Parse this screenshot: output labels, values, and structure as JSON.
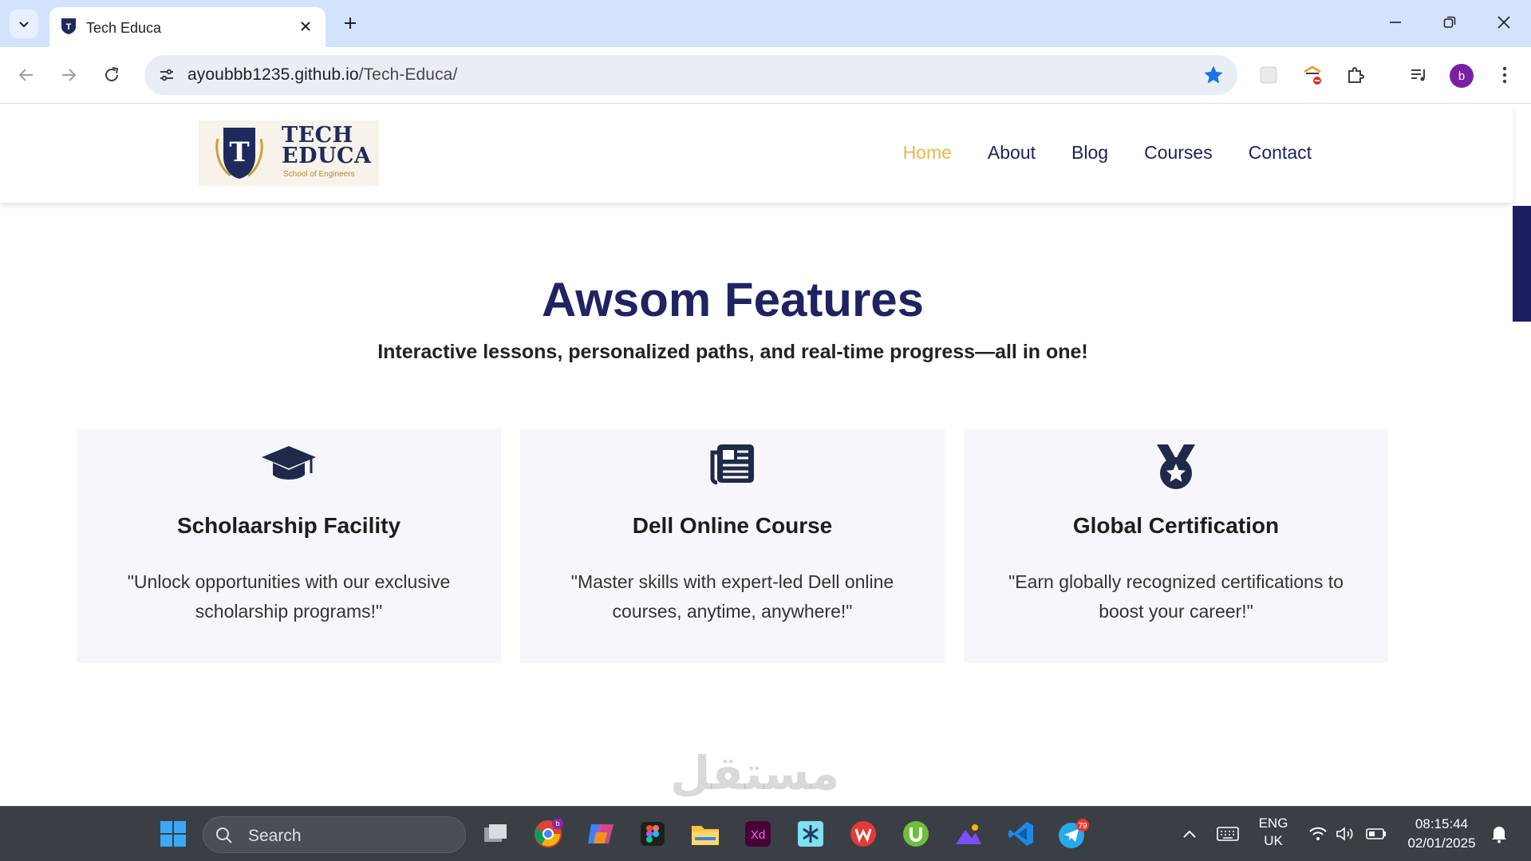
{
  "browser": {
    "tab_title": "Tech Educa",
    "url_host": "ayoubbb1235.github.io",
    "url_path": "/Tech-Educa/",
    "profile_initial": "b"
  },
  "site": {
    "logo": {
      "word1": "TECH",
      "word2": "EDUCA",
      "tagline": "School of Engineers",
      "letter": "T"
    },
    "nav": [
      {
        "label": "Home",
        "active": true
      },
      {
        "label": "About",
        "active": false
      },
      {
        "label": "Blog",
        "active": false
      },
      {
        "label": "Courses",
        "active": false
      },
      {
        "label": "Contact",
        "active": false
      }
    ],
    "features": {
      "title": "Awsom Features",
      "subtitle": "Interactive lessons, personalized paths, and real-time progress—all in one!",
      "cards": [
        {
          "icon": "graduation-cap-icon",
          "title": "Scholaarship Facility",
          "text": "\"Unlock opportunities with our exclusive scholarship programs!\""
        },
        {
          "icon": "newspaper-icon",
          "title": "Dell Online Course",
          "text": "\"Master skills with expert-led Dell online courses, anytime, anywhere!\""
        },
        {
          "icon": "medal-icon",
          "title": "Global Certification",
          "text": "\"Earn globally recognized certifications to boost your career!\""
        }
      ]
    }
  },
  "taskbar": {
    "search_placeholder": "Search",
    "language": "ENG",
    "region": "UK",
    "time": "08:15:44",
    "date": "02/01/2025",
    "telegram_badge": "79",
    "chrome_badge": "b"
  },
  "watermark": "مستقل"
}
